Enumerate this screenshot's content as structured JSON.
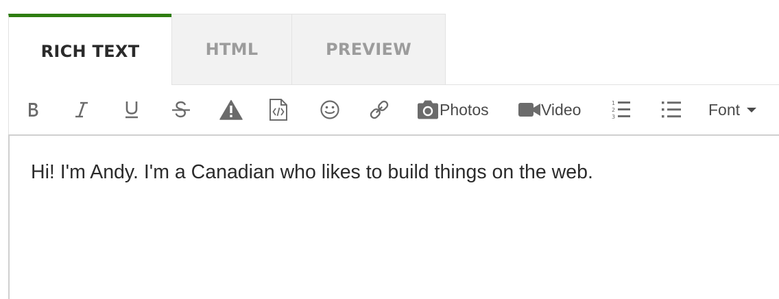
{
  "tabs": {
    "rich_text": "RICH TEXT",
    "html": "HTML",
    "preview": "PREVIEW",
    "active": "rich_text",
    "active_accent": "#2e7d10"
  },
  "toolbar": {
    "buttons": [
      {
        "name": "bold",
        "icon": "bold-icon"
      },
      {
        "name": "italic",
        "icon": "italic-icon"
      },
      {
        "name": "underline",
        "icon": "underline-icon"
      },
      {
        "name": "strikethrough",
        "icon": "strikethrough-icon"
      },
      {
        "name": "warning",
        "icon": "warning-icon"
      },
      {
        "name": "code",
        "icon": "code-file-icon"
      },
      {
        "name": "emoji",
        "icon": "smiley-icon"
      },
      {
        "name": "link",
        "icon": "link-icon"
      },
      {
        "name": "ordered-list",
        "icon": "ordered-list-icon"
      },
      {
        "name": "unordered-list",
        "icon": "unordered-list-icon"
      }
    ],
    "photos_label": "Photos",
    "video_label": "Video",
    "font_label": "Font"
  },
  "content": {
    "text": "Hi! I'm Andy. I'm a Canadian who likes to build things on the web."
  }
}
